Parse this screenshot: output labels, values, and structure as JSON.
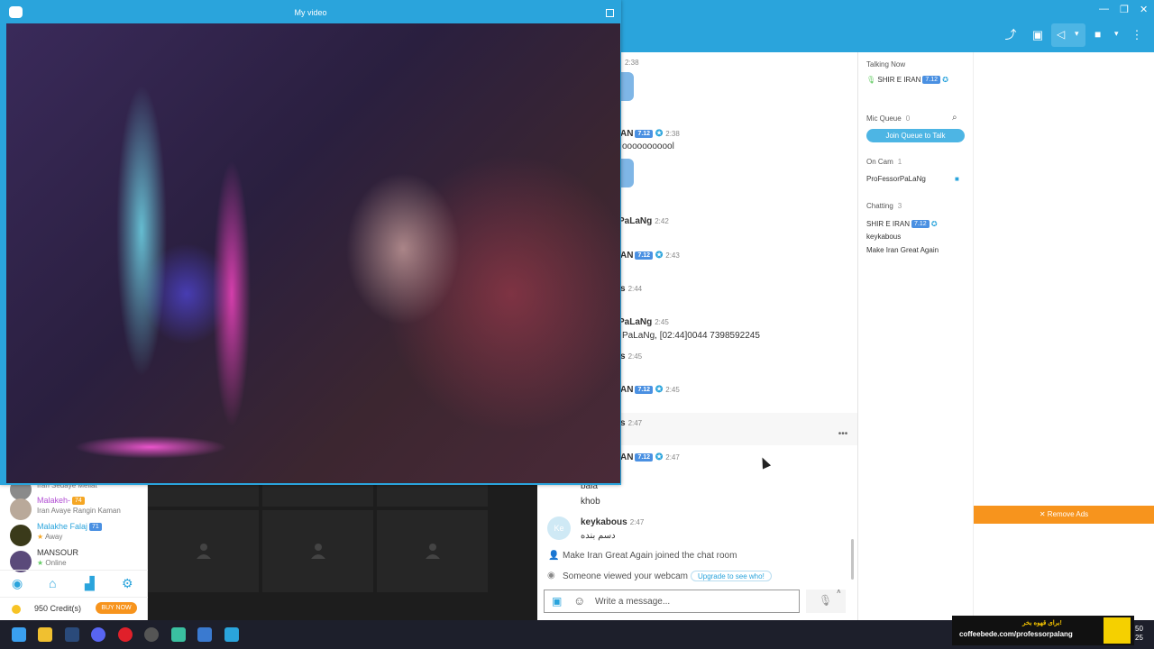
{
  "window": {
    "video_title": "My video"
  },
  "sidebar": {
    "users": [
      {
        "name": "",
        "status": "Iran Sedaye Mellat",
        "color": "#333333",
        "badge": ""
      },
      {
        "name": "Malakeh-",
        "status": "Iran Avaye Rangin Kaman",
        "color": "#b24fd4",
        "badge": "74"
      },
      {
        "name": "Malakhe Falaj",
        "status": "Away",
        "color": "#2aa4dc",
        "badge": "71"
      },
      {
        "name": "MANSOUR",
        "status": "Online",
        "color": "#333333",
        "badge": ""
      }
    ],
    "credits": "950 Credit(s)",
    "buy_now": "BUY NOW"
  },
  "chat": {
    "messages": [
      {
        "name": "",
        "time": "2:38",
        "text": ""
      },
      {
        "name": "AN",
        "badge": "7.12",
        "time": "2:38",
        "text": "ooooooooool"
      },
      {
        "name": "PaLaNg",
        "time": "2:42",
        "text": ""
      },
      {
        "name": "AN",
        "badge": "7.12",
        "time": "2:43",
        "text": ""
      },
      {
        "name": "s",
        "time": "2:44",
        "text": ""
      },
      {
        "name": "PaLaNg",
        "time": "2:45",
        "text": "PaLaNg, [02:44]0044 7398592245"
      },
      {
        "name": "s",
        "time": "2:45",
        "text": ""
      },
      {
        "name": "AN",
        "badge": "7.12",
        "time": "2:45",
        "text": ""
      },
      {
        "name": "s",
        "time": "2:47",
        "text": ""
      },
      {
        "name": "AN",
        "badge": "7.12",
        "time": "2:47",
        "text": ""
      }
    ],
    "lines_after": [
      "bala",
      "khob"
    ],
    "keykabous": {
      "avatar": "Ke",
      "name": "keykabous",
      "time": "2:47",
      "text": "دسم بنده"
    },
    "system_join": "Make Iran Great Again joined the chat room",
    "system_view": "Someone viewed your webcam",
    "upgrade": "Upgrade to see who!",
    "input_placeholder": "Write a message...",
    "more": "•••"
  },
  "info": {
    "talking_now": "Talking Now",
    "talker": "SHIR E IRAN",
    "talker_badge": "7.12",
    "mic_queue": "Mic Queue",
    "mic_queue_count": "0",
    "join_queue": "Join Queue to Talk",
    "on_cam": "On Cam",
    "on_cam_count": "1",
    "on_cam_user": "ProFessorPaLaNg",
    "chatting": "Chatting",
    "chatting_count": "3",
    "chatting_users": [
      "SHIR E IRAN",
      "keykabous",
      "Make Iran Great Again"
    ],
    "chatting_badge": "7.12"
  },
  "ads": {
    "remove": "✕ Remove Ads"
  },
  "coffee": {
    "line1": "برای قهوه بخر!",
    "line2": "coffeebede.com/professorpalang"
  },
  "clock": {
    "line1": "50",
    "line2": "25"
  },
  "colors": {
    "primary": "#2aa4dc",
    "accent": "#f7941d"
  }
}
